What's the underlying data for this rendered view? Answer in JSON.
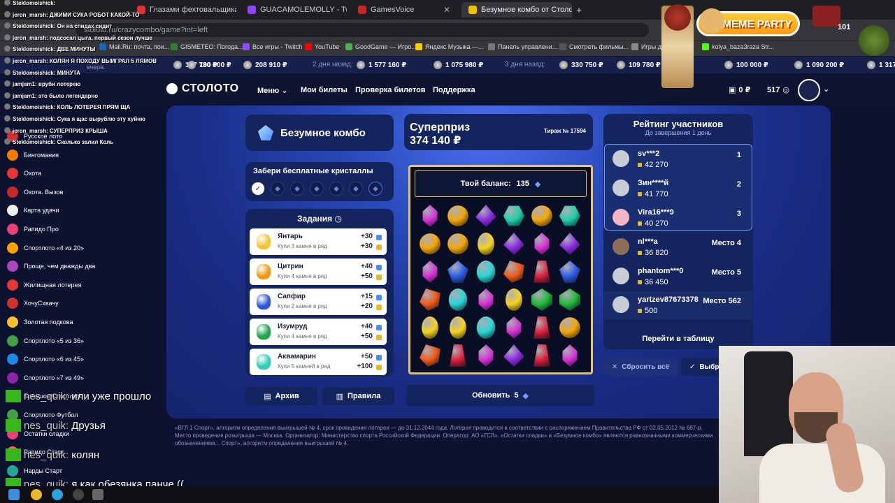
{
  "browser": {
    "tabs": [
      {
        "title": "Глазами фехтовальщика: Суд",
        "color": "#e03030"
      },
      {
        "title": "GUACAMOLEMOLLY - Twitch",
        "color": "#9146ff"
      },
      {
        "title": "GamesVoice",
        "color": "#c62828"
      },
      {
        "title": "Безумное комбо от Столото",
        "color": "#f2c200"
      }
    ],
    "url": "stoloto.ru/crazycombo/game?int=left",
    "bookmarks": [
      {
        "label": "Mail.Ru: почта, пои...",
        "color": "#1565c0"
      },
      {
        "label": "GISMETEO: Погода...",
        "color": "#2e7d32"
      },
      {
        "label": "Все игры - Twitch",
        "color": "#9146ff"
      },
      {
        "label": "YouTube",
        "color": "#ff0000"
      },
      {
        "label": "GoodGame — Игро...",
        "color": "#4caf50"
      },
      {
        "label": "Яндекс Музыка —...",
        "color": "#ffcc00"
      },
      {
        "label": "Панель управлени...",
        "color": "#777777"
      },
      {
        "label": "Смотреть фильмы...",
        "color": "#555555"
      },
      {
        "label": "Игры для ...",
        "color": "#888888"
      },
      {
        "label": "kolya_baza3raza Str...",
        "color": "#53fc18"
      }
    ]
  },
  "ticker": {
    "items": [
      "137 730 ₽",
      "100 000 ₽",
      "208 910 ₽",
      "2 дня назад:",
      "1 577 160 ₽",
      "1 075 980 ₽",
      "3 дня назад:",
      "330 750 ₽",
      "109 780 ₽",
      "100 000 ₽",
      "1 090 200 ₽",
      "1 317"
    ],
    "partial": "вчера."
  },
  "header": {
    "logo": "СТОЛОТО",
    "nav": [
      "Меню",
      "Мои билеты",
      "Проверка билетов",
      "Поддержка"
    ],
    "balance": "0 ₽",
    "bonus": "517"
  },
  "game": {
    "title": "Безумное комбо",
    "crystals_title": "Забери бесплатные кристаллы",
    "tasks_title": "Задания",
    "tasks": [
      {
        "name": "Янтарь",
        "desc": "Купи 3 камня в ряд",
        "r1": "+30",
        "r2": "+30",
        "color": "#f5c433"
      },
      {
        "name": "Цитрин",
        "desc": "Купи 4 камня в ряд",
        "r1": "+40",
        "r2": "+50",
        "color": "#f09a12"
      },
      {
        "name": "Сапфир",
        "desc": "Купи 2 камня в ряд",
        "r1": "+15",
        "r2": "+20",
        "color": "#2d56d8"
      },
      {
        "name": "Изумруд",
        "desc": "Купи 4 камня в ряд",
        "r1": "+40",
        "r2": "+50",
        "color": "#1fa64a"
      },
      {
        "name": "Аквамарин",
        "desc": "Купи 5 камней в ряд",
        "r1": "+50",
        "r2": "+100",
        "color": "#2cd1b5"
      }
    ],
    "archive": "Архив",
    "rules": "Правила",
    "superprize_label": "Суперприз",
    "superprize_value": "374 140 ₽",
    "draw": "Тираж № 17594",
    "balance_label": "Твой баланс:",
    "balance_value": "135",
    "refresh_label": "Обновить",
    "refresh_count": "5",
    "reset": "Сбросить всё",
    "choose": "Выбр"
  },
  "gem_colors": {
    "p": "#d62fd6",
    "o": "#f4a80e",
    "v": "#8a2be2",
    "t": "#1fcfa9",
    "y": "#f5d21e",
    "r": "#e0203c",
    "b": "#2f5fe8",
    "c": "#29d6d6",
    "g": "#22b83a",
    "e": "#f05a1a"
  },
  "gems": [
    [
      "p",
      "o",
      "v",
      "t",
      "o",
      "t"
    ],
    [
      "o",
      "o",
      "y",
      "v",
      "p",
      "v"
    ],
    [
      "p",
      "b",
      "c",
      "e",
      "r",
      "b"
    ],
    [
      "e",
      "c",
      "p",
      "y",
      "g",
      "g"
    ],
    [
      "y",
      "y",
      "c",
      "p",
      "r",
      "o"
    ],
    [
      "e",
      "r",
      "p",
      "v",
      "r",
      "p"
    ]
  ],
  "rating": {
    "title": "Рейтинг участников",
    "subtitle": "До завершения 1 день",
    "players": [
      {
        "name": "sv***2",
        "points": "42 270",
        "place": "1"
      },
      {
        "name": "Зин****й",
        "points": "41 770",
        "place": "2"
      },
      {
        "name": "Vira16***9",
        "points": "40 270",
        "place": "3"
      },
      {
        "name": "nl***a",
        "points": "36 820",
        "place": "Место 4"
      },
      {
        "name": "phantom***0",
        "points": "36 450",
        "place": "Место 5"
      },
      {
        "name": "yartzev87673378",
        "points": "500",
        "place": "Место 562"
      }
    ],
    "to_table": "Перейти в таблицу"
  },
  "legal": "«ВГЛ 1 Спорт», алгоритм определения выигрышей № 4, срок проведения лотереи — до 31.12.2044 года. Лотерея проводится в соответствии с распоряжением Правительства РФ от 02.05.2012 № 687-р. Место проведения розыгрыша — Москва. Организатор: Министерство спорта Российской Федерации. Оператор: АО «ГСЛ». «Остатки сладки» и «Безумное комбо» являются равнозначными коммерческими обозначениями... Спорт», алгоритм определения выигрышей № 4.",
  "chat_small": [
    {
      "user": "Steklomoishick:",
      "text": ""
    },
    {
      "user": "jeron_marsh:",
      "text": "ДЖИМИ СУКА РОБОТ КАКОЙ-ТО"
    },
    {
      "user": "Steklomoishick:",
      "text": "Он на спидах сидит"
    },
    {
      "user": "jeron_marsh:",
      "text": "подсосал цыга, первый сезон лучше"
    },
    {
      "user": "Steklomoishick:",
      "text": "ДВЕ МИНУТЫ"
    },
    {
      "user": "jeron_marsh:",
      "text": "КОЛЯН Я ПОХОДУ ВЫИГРАЛ 5 ЛЯМОВ"
    },
    {
      "user": "Steklomoishick:",
      "text": "МИНУТА"
    },
    {
      "user": "jamjam1:",
      "text": "вруби лотерею"
    },
    {
      "user": "jamjam1:",
      "text": "это было легендарно"
    },
    {
      "user": "Steklomoishick:",
      "text": "КОЛЬ ЛОТЕРЕЯ ПРЯМ ЩА"
    },
    {
      "user": "Steklomoishick:",
      "text": "Сука я щас вырублю эту хуйню"
    },
    {
      "user": "jeron_marsh:",
      "text": "СУПЕРПРИЗ КРЫША"
    },
    {
      "user": "Steklomoishick:",
      "text": "Сколько залил Коль"
    }
  ],
  "chat_big": [
    {
      "user": "nes_quik:",
      "text": "или уже прошло"
    },
    {
      "user": "nes_quik:",
      "text": "Друзья"
    },
    {
      "user": "nes_quik:",
      "text": "колян"
    },
    {
      "user": "nes_quik:",
      "text": "я как обезянка панче (("
    }
  ],
  "game_list": [
    {
      "label": "Русское лото",
      "color": "#d32f2f"
    },
    {
      "label": "Бингомания",
      "color": "#f57c00"
    },
    {
      "label": "Охота",
      "color": "#e53935"
    },
    {
      "label": "Охота. Вызов",
      "color": "#c62828"
    },
    {
      "label": "Карта удачи",
      "color": "#eeeeee"
    },
    {
      "label": "Рапидо Про",
      "color": "#ec407a"
    },
    {
      "label": "Спортлото «4 из 20»",
      "color": "#ffa000"
    },
    {
      "label": "Проще, чем дважды два",
      "color": "#ab47bc"
    },
    {
      "label": "Жилищная лотерея",
      "color": "#e53935"
    },
    {
      "label": "ХочуСхвачу",
      "color": "#d32f2f"
    },
    {
      "label": "Золотая подкова",
      "color": "#fbc02d"
    },
    {
      "label": "Спортлото «5 из 36»",
      "color": "#43a047"
    },
    {
      "label": "Спортлото «6 из 45»",
      "color": "#1e88e5"
    },
    {
      "label": "Спортлото «7 из 49»",
      "color": "#8e24aa"
    },
    {
      "label": "Большое Спортлото",
      "color": "#e53935"
    },
    {
      "label": "Спортлото Футбол",
      "color": "#43a047"
    },
    {
      "label": "Остатки сладки",
      "color": "#ec407a"
    },
    {
      "label": "Рапидо Старт",
      "color": "#ff7043"
    },
    {
      "label": "Нарды Старт",
      "color": "#26a69a"
    }
  ],
  "overlay": {
    "meme": "MEME PARTY",
    "counter": "101"
  }
}
